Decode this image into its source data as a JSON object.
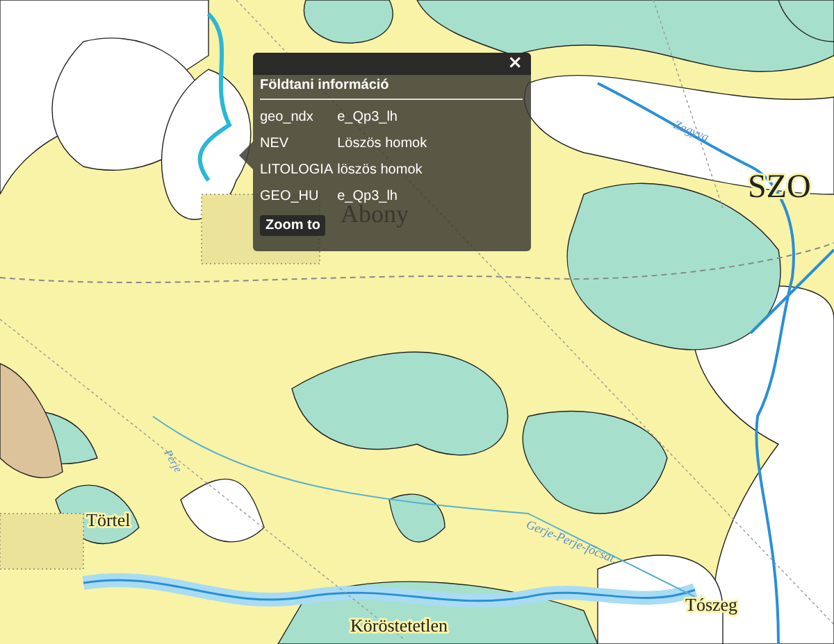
{
  "map": {
    "places": [
      {
        "name": "Abony"
      },
      {
        "name": "SZO"
      },
      {
        "name": "Törtel"
      },
      {
        "name": "Köröstetetlen"
      },
      {
        "name": "Tószeg"
      }
    ],
    "waterways": [
      {
        "name": "Zagyva"
      },
      {
        "name": "Perje"
      },
      {
        "name": "Gerje-Perje-főcsat."
      }
    ]
  },
  "popup": {
    "close": "×",
    "title": "Földtani információ",
    "rows": [
      {
        "field": "geo_ndx",
        "value": "e_Qp3_lh"
      },
      {
        "field": "NEV",
        "value": "Löszös homok"
      },
      {
        "field": "LITOLOGIA",
        "value": "löszös homok"
      },
      {
        "field": "GEO_HU",
        "value": "e_Qp3_lh"
      }
    ],
    "button": "Zoom to"
  }
}
